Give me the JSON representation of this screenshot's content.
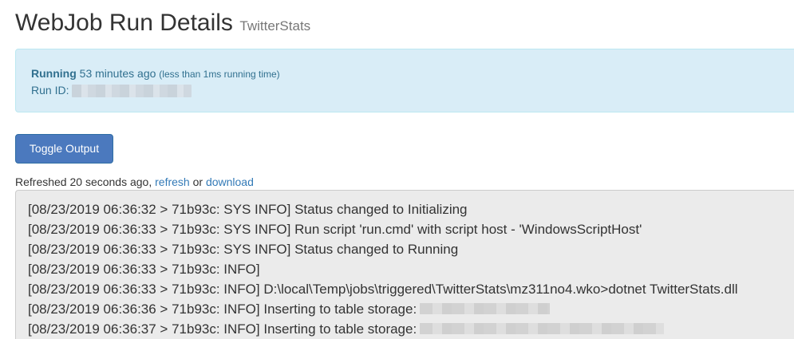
{
  "header": {
    "title": "WebJob Run Details",
    "subtitle": "TwitterStats"
  },
  "status": {
    "state": "Running",
    "age": "53 minutes ago",
    "running_time": "(less than 1ms running time)",
    "run_id_label": "Run ID:"
  },
  "toolbar": {
    "toggle_output_label": "Toggle Output"
  },
  "refresh": {
    "prefix": "Refreshed 20 seconds ago,",
    "refresh_link": "refresh",
    "conjunction": "or",
    "download_link": "download"
  },
  "log": {
    "lines": [
      "[08/23/2019 06:36:32 > 71b93c: SYS INFO] Status changed to Initializing",
      "[08/23/2019 06:36:33 > 71b93c: SYS INFO] Run script 'run.cmd' with script host - 'WindowsScriptHost'",
      "[08/23/2019 06:36:33 > 71b93c: SYS INFO] Status changed to Running",
      "[08/23/2019 06:36:33 > 71b93c: INFO]",
      "[08/23/2019 06:36:33 > 71b93c: INFO] D:\\local\\Temp\\jobs\\triggered\\TwitterStats\\mz311no4.wko>dotnet TwitterStats.dll",
      "[08/23/2019 06:36:36 > 71b93c: INFO] Inserting to table storage:",
      "[08/23/2019 06:36:37 > 71b93c: INFO] Inserting to table storage:"
    ]
  }
}
